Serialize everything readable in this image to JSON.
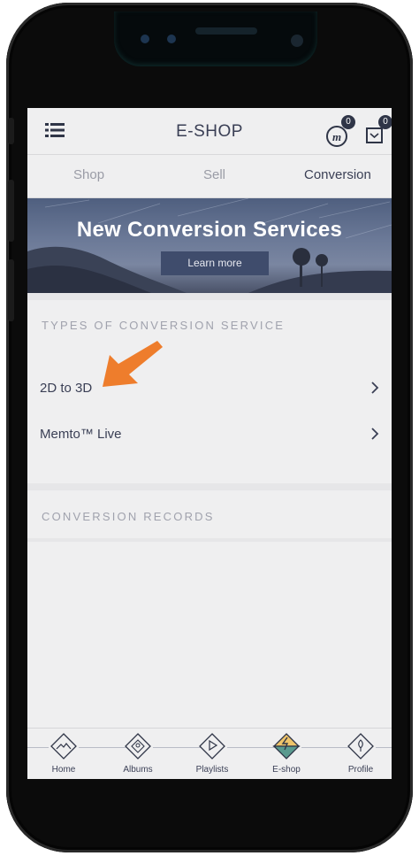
{
  "header": {
    "title": "E-SHOP",
    "memto_count": "0",
    "cart_count": "0"
  },
  "tabs": [
    {
      "label": "Shop",
      "active": false
    },
    {
      "label": "Sell",
      "active": false
    },
    {
      "label": "Conversion",
      "active": true
    }
  ],
  "banner": {
    "title": "New Conversion Services",
    "button": "Learn more"
  },
  "types_section": {
    "label": "TYPES OF CONVERSION SERVICE",
    "items": [
      {
        "label": "2D to 3D"
      },
      {
        "label": "Memto™ Live"
      }
    ]
  },
  "records_section": {
    "label": "CONVERSION RECORDS"
  },
  "tabbar": [
    {
      "label": "Home",
      "icon": "home-mountain-icon"
    },
    {
      "label": "Albums",
      "icon": "albums-icon"
    },
    {
      "label": "Playlists",
      "icon": "play-icon"
    },
    {
      "label": "E-shop",
      "icon": "eshop-bolt-icon",
      "active": true
    },
    {
      "label": "Profile",
      "icon": "profile-icon"
    }
  ],
  "colors": {
    "accent_arrow": "#ee7d2c",
    "text": "#3a3f55",
    "banner": "#5d6b8a"
  }
}
